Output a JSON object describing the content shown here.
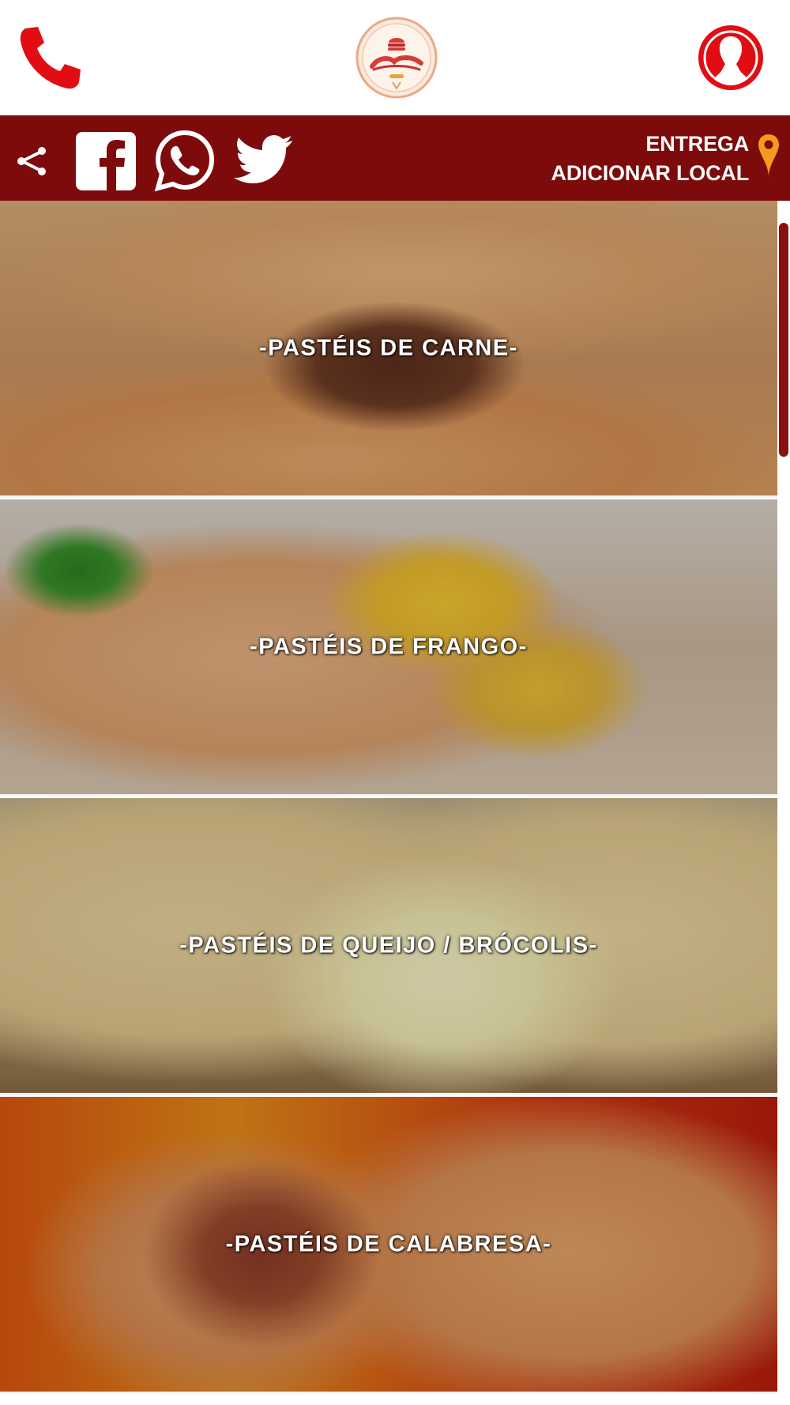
{
  "header": {
    "phone_icon": "phone-icon",
    "logo_icon": "brand-logo",
    "user_icon": "user-icon"
  },
  "share_bar": {
    "share_icon": "share-icon",
    "facebook_icon": "facebook-icon",
    "whatsapp_icon": "whatsapp-icon",
    "twitter_icon": "twitter-icon",
    "delivery_label": "ENTREGA",
    "add_location_label": "ADICIONAR LOCAL",
    "pin_icon": "location-pin-icon"
  },
  "categories": [
    {
      "label": "-PASTÉIS DE CARNE-"
    },
    {
      "label": "-PASTÉIS DE FRANGO-"
    },
    {
      "label": "-PASTÉIS DE QUEIJO / BRÓCOLIS-"
    },
    {
      "label": "-PASTÉIS DE CALABRESA-"
    }
  ],
  "colors": {
    "brand_red": "#e10d12",
    "bar_dark_red": "#7e0b0b",
    "pin_orange": "#f39a1f",
    "white": "#ffffff"
  }
}
